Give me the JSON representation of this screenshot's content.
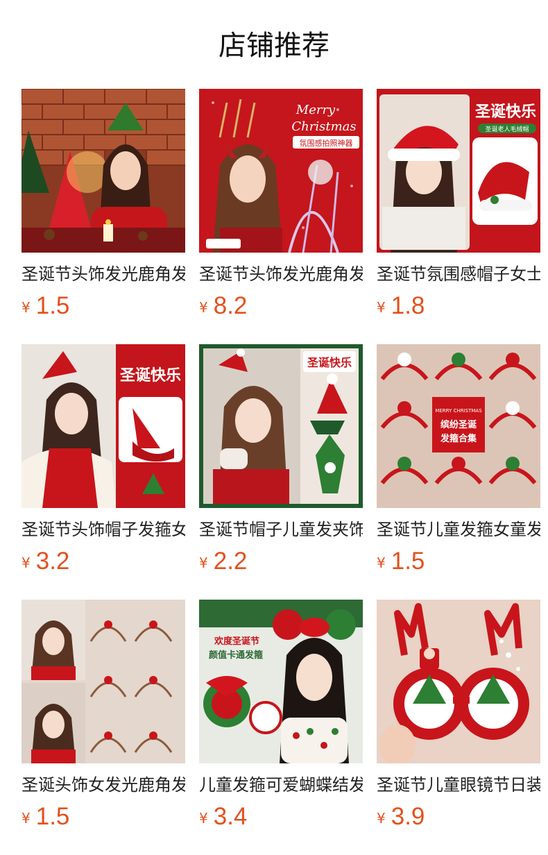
{
  "header": {
    "title": "店铺推荐"
  },
  "products": [
    {
      "name": "圣诞节头饰发光鹿角发箍",
      "currency": "¥",
      "price": "1.5"
    },
    {
      "name": "圣诞节头饰发光鹿角发箍",
      "currency": "¥",
      "price": "8.2"
    },
    {
      "name": "圣诞节氛围感帽子女士",
      "currency": "¥",
      "price": "1.8"
    },
    {
      "name": "圣诞节头饰帽子发箍女",
      "currency": "¥",
      "price": "3.2"
    },
    {
      "name": "圣诞节帽子儿童发夹饰",
      "currency": "¥",
      "price": "2.2"
    },
    {
      "name": "圣诞节儿童发箍女童发",
      "currency": "¥",
      "price": "1.5"
    },
    {
      "name": "圣诞头饰女发光鹿角发",
      "currency": "¥",
      "price": "1.5"
    },
    {
      "name": "儿童发箍可爱蝴蝶结发",
      "currency": "¥",
      "price": "3.4"
    },
    {
      "name": "圣诞节儿童眼镜节日装",
      "currency": "¥",
      "price": "3.9"
    }
  ],
  "image_text": {
    "p2_line1": "Merry",
    "p2_line2": "Christmas",
    "p2_banner": "氛围感拍照神器",
    "p3_title": "圣诞快乐",
    "p3_sub": "圣诞老人毛绒帽",
    "p4_title": "圣诞快乐",
    "p5_title": "圣诞快乐",
    "p6_line1": "MERRY CHRISTMAS",
    "p6_line2": "缤纷圣诞",
    "p6_line3": "发箍合集",
    "p8_line1": "欢度圣诞节",
    "p8_line2": "颜值卡通发箍"
  },
  "colors": {
    "price": "#e4501c",
    "christmas_red": "#c8151b"
  }
}
